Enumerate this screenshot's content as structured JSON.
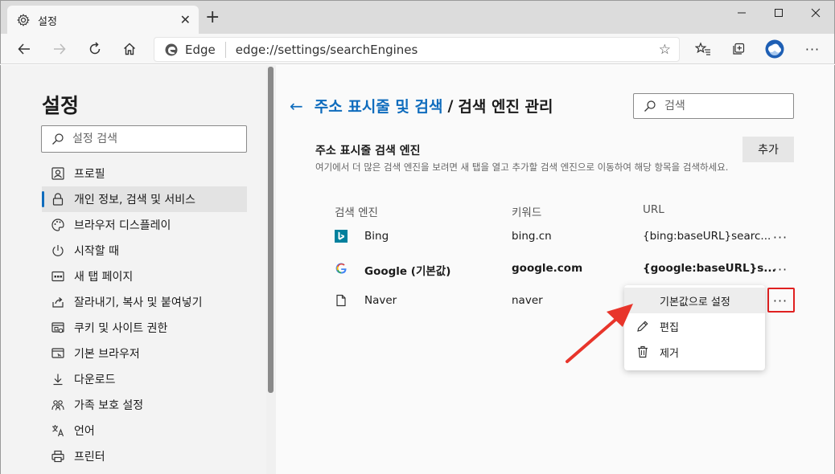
{
  "browser": {
    "tab_title": "설정",
    "site_name": "Edge",
    "url": "edge://settings/searchEngines"
  },
  "sidebar": {
    "title": "설정",
    "search_placeholder": "설정 검색",
    "items": [
      {
        "label": "프로필",
        "icon": "profile-icon"
      },
      {
        "label": "개인 정보, 검색 및 서비스",
        "icon": "lock-icon",
        "active": true
      },
      {
        "label": "브라우저 디스플레이",
        "icon": "palette-icon"
      },
      {
        "label": "시작할 때",
        "icon": "power-icon"
      },
      {
        "label": "새 탭 페이지",
        "icon": "new-tab-page-icon"
      },
      {
        "label": "잘라내기, 복사 및 붙여넣기",
        "icon": "share-icon"
      },
      {
        "label": "쿠키 및 사이트 권한",
        "icon": "site-permissions-icon"
      },
      {
        "label": "기본 브라우저",
        "icon": "default-browser-icon"
      },
      {
        "label": "다운로드",
        "icon": "download-icon"
      },
      {
        "label": "가족 보호 설정",
        "icon": "family-icon"
      },
      {
        "label": "언어",
        "icon": "language-icon"
      },
      {
        "label": "프린터",
        "icon": "printer-icon"
      }
    ]
  },
  "main": {
    "breadcrumb_parent": "주소 표시줄 및 검색",
    "breadcrumb_separator": "/",
    "breadcrumb_current": "검색 엔진 관리",
    "search_placeholder": "검색",
    "section_title": "주소 표시줄 검색 엔진",
    "section_description": "여기에서 더 많은 검색 엔진을 보려면 새 탭을 열고 추가할 검색 엔진으로 이동하여 해당 항목을 검색하세요.",
    "add_button": "추가",
    "columns": {
      "engine": "검색 엔진",
      "keyword": "키워드",
      "url": "URL"
    },
    "engines": [
      {
        "name": "Bing",
        "keyword": "bing.cn",
        "url": "{bing:baseURL}searc...",
        "default": false,
        "icon": "bing-icon"
      },
      {
        "name": "Google (기본값)",
        "keyword": "google.com",
        "url": "{google:baseURL}s...",
        "default": true,
        "icon": "google-icon"
      },
      {
        "name": "Naver",
        "keyword": "naver",
        "url": "",
        "default": false,
        "icon": "document-icon"
      }
    ],
    "more_label": "···"
  },
  "context_menu": {
    "items": [
      {
        "label": "기본값으로 설정"
      },
      {
        "label": "편집",
        "icon": "pencil-icon"
      },
      {
        "label": "제거",
        "icon": "trash-icon"
      }
    ]
  },
  "colors": {
    "accent": "#0f6cbd",
    "annotation_red": "#e02020"
  }
}
